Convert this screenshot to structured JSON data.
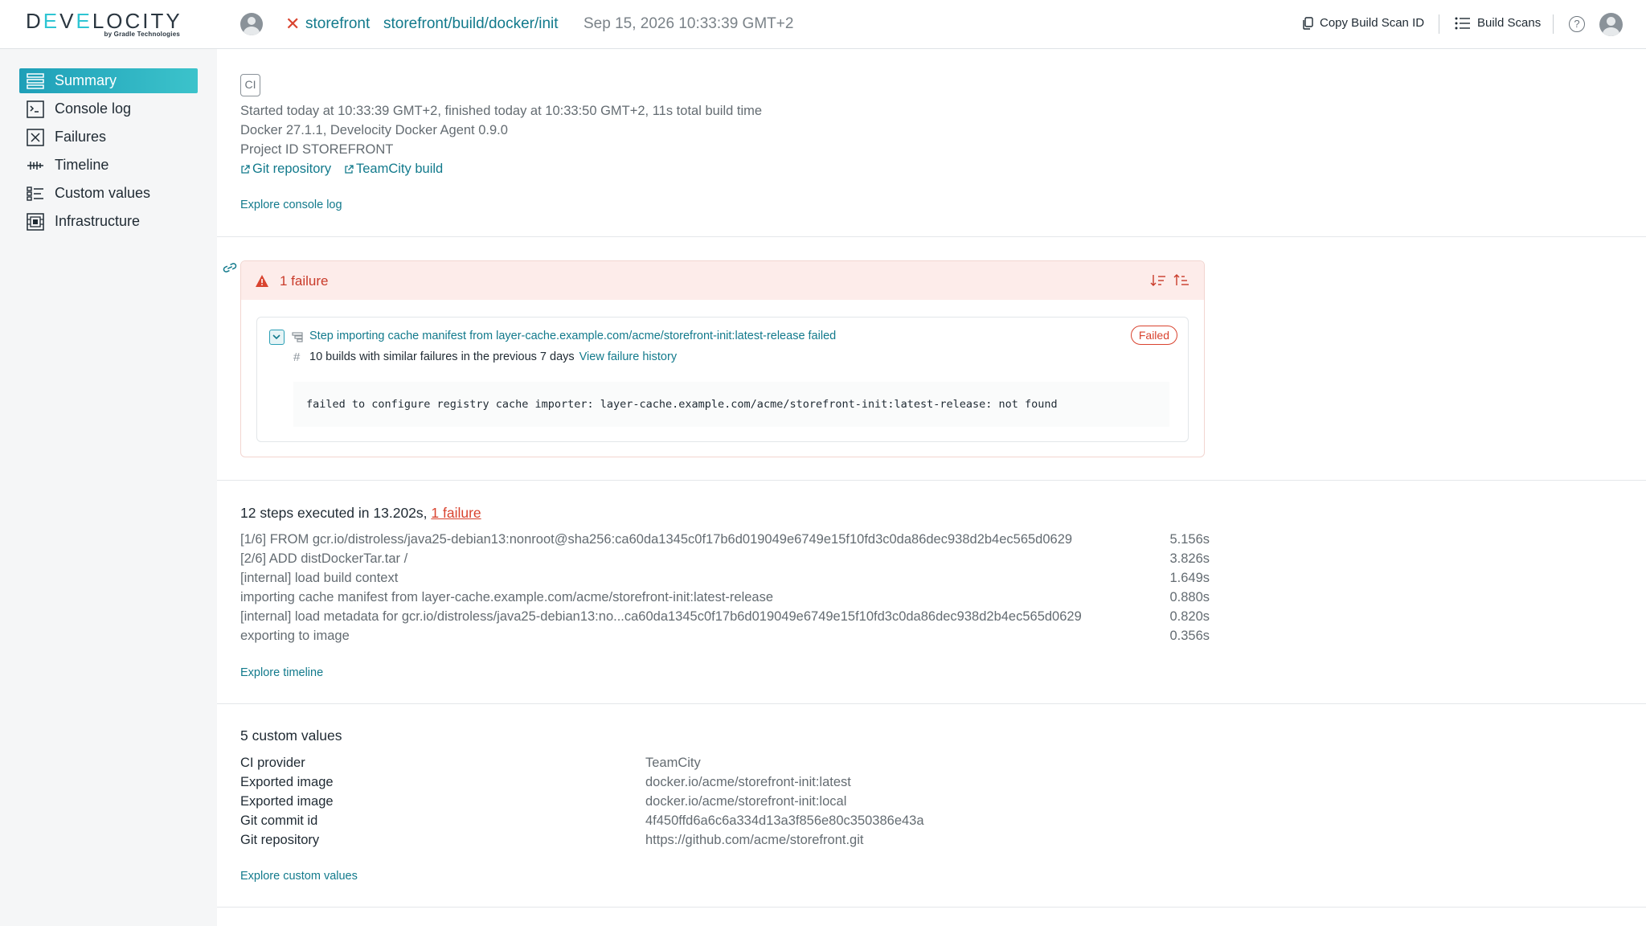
{
  "header": {
    "logo_main": "DEVELOCITY",
    "logo_sub": "by Gradle Technologies",
    "project": "storefront",
    "path": "storefront/build/docker/init",
    "date": "Sep 15, 2026 10:33:39 GMT+2",
    "copy_id_label": "Copy Build Scan ID",
    "build_scans_label": "Build Scans",
    "help_glyph": "?"
  },
  "sidebar": {
    "items": [
      {
        "label": "Summary",
        "icon": "summary-icon"
      },
      {
        "label": "Console log",
        "icon": "console-icon"
      },
      {
        "label": "Failures",
        "icon": "failures-icon"
      },
      {
        "label": "Timeline",
        "icon": "timeline-icon"
      },
      {
        "label": "Custom values",
        "icon": "custom-values-icon"
      },
      {
        "label": "Infrastructure",
        "icon": "infrastructure-icon"
      }
    ]
  },
  "summary": {
    "ci_badge": "CI",
    "started": "Started today at 10:33:39 GMT+2, finished today at 10:33:50 GMT+2, 11s total build time",
    "docker": "Docker 27.1.1, Develocity Docker Agent 0.9.0",
    "project_id": "Project ID STOREFRONT",
    "git_link": "Git repository",
    "teamcity_link": "TeamCity build",
    "explore_console": "Explore console log"
  },
  "failures": {
    "count_label": "1 failure",
    "title": "Step importing cache manifest from layer-cache.example.com/acme/storefront-init:latest-release failed",
    "status": "Failed",
    "similar_text": "10 builds with similar failures in the previous 7 days",
    "history_link": "View failure history",
    "message": "failed to configure registry cache importer: layer-cache.example.com/acme/storefront-init:latest-release: not found"
  },
  "steps": {
    "title_prefix": "12 steps executed in 13.202s, ",
    "failure_link": "1 failure",
    "rows": [
      {
        "name": "[1/6] FROM gcr.io/distroless/java25-debian13:nonroot@sha256:ca60da1345c0f17b6d019049e6749e15f10fd3c0da86dec938d2b4ec565d0629",
        "duration": "5.156s"
      },
      {
        "name": "[2/6] ADD distDockerTar.tar /",
        "duration": "3.826s"
      },
      {
        "name": "[internal] load build context",
        "duration": "1.649s"
      },
      {
        "name": "importing cache manifest from layer-cache.example.com/acme/storefront-init:latest-release",
        "duration": "0.880s"
      },
      {
        "name": "[internal] load metadata for gcr.io/distroless/java25-debian13:no...ca60da1345c0f17b6d019049e6749e15f10fd3c0da86dec938d2b4ec565d0629",
        "duration": "0.820s"
      },
      {
        "name": "exporting to image",
        "duration": "0.356s"
      }
    ],
    "explore_timeline": "Explore timeline"
  },
  "custom_values": {
    "title": "5 custom values",
    "rows": [
      {
        "key": "CI provider",
        "value": "TeamCity"
      },
      {
        "key": "Exported image",
        "value": "docker.io/acme/storefront-init:latest"
      },
      {
        "key": "Exported image",
        "value": "docker.io/acme/storefront-init:local"
      },
      {
        "key": "Git commit id",
        "value": "4f450ffd6a6c6a334d13a3f856e80c350386e43a"
      },
      {
        "key": "Git repository",
        "value": "https://github.com/acme/storefront.git"
      }
    ],
    "explore_custom": "Explore custom values"
  },
  "colors": {
    "accent": "#127a8c",
    "active_nav": "#1e9fb8",
    "failure": "#d9432f",
    "failure_bg": "#fdecea"
  }
}
